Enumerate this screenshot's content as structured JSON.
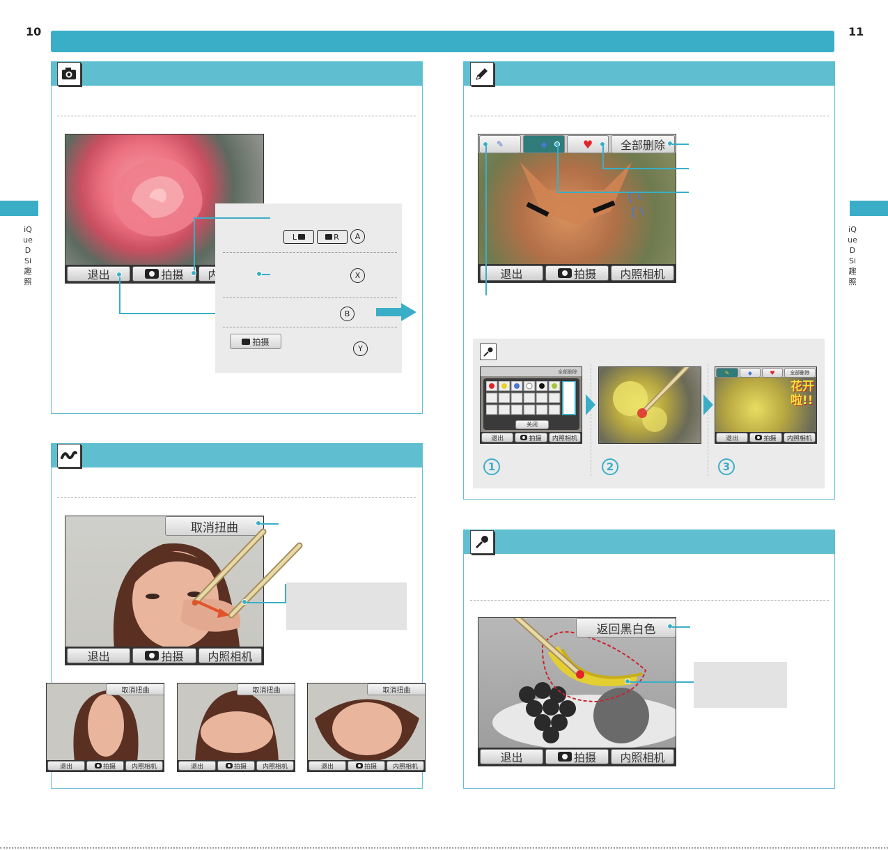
{
  "page": {
    "left_number": "10",
    "right_number": "11",
    "side_label": "iQueDSi趣照"
  },
  "ds_buttons": {
    "exit": "退出",
    "shoot": "拍摄",
    "inner_camera": "内照相机"
  },
  "camera_section": {
    "icon": "camera-icon",
    "keys": {
      "l_key": "L",
      "r_key": "R",
      "a_key": "A",
      "x_key": "X",
      "b_key": "B",
      "y_key": "Y"
    },
    "shoot_button_label": "拍摄"
  },
  "distort_section": {
    "icon": "wave-icon",
    "cancel_label": "取消扭曲"
  },
  "draw_section": {
    "icon": "pencil-icon",
    "erase_all_label": "全部删除",
    "sub_icon": "dropper-icon",
    "close_label": "关闭",
    "steps": [
      "1",
      "2",
      "3"
    ],
    "flower_caption": "花开啦!!"
  },
  "color_section": {
    "icon": "dropper-icon",
    "back_bw_label": "返回黑白色"
  },
  "colors": {
    "accent": "#3aaec7",
    "panel_header": "#5fbfd1",
    "callout_grey": "#e3e3e3"
  }
}
